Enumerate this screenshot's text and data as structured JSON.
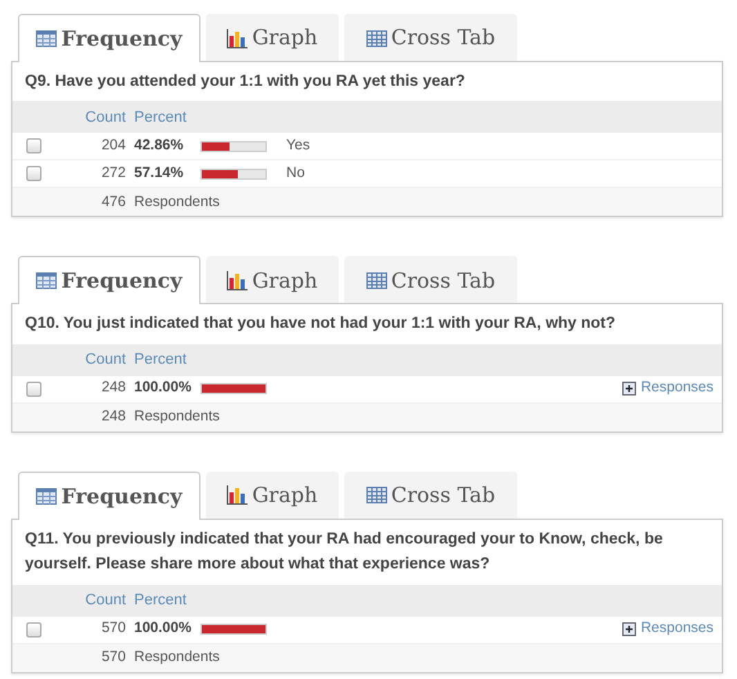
{
  "sections": [
    {
      "tabs": [
        {
          "label": "Frequency",
          "kind": "table",
          "selected": true
        },
        {
          "label": "Graph",
          "kind": "chart",
          "selected": false
        },
        {
          "label": "Cross Tab",
          "kind": "crosstab",
          "selected": false
        }
      ],
      "question": "Q9. Have you attended your 1:1 with you RA yet this year?",
      "columns": [
        "Count",
        "Percent"
      ],
      "rows": [
        {
          "checked": false,
          "count": "204",
          "percent": "42.86%",
          "level": 0.4286,
          "label": "Yes"
        },
        {
          "checked": false,
          "count": "272",
          "percent": "57.14%",
          "level": 0.5714,
          "label": "No"
        }
      ],
      "respondents": {
        "count": "476",
        "label": "Respondents"
      }
    },
    {
      "tabs": [
        {
          "label": "Frequency",
          "kind": "table",
          "selected": true
        },
        {
          "label": "Graph",
          "kind": "chart",
          "selected": false
        },
        {
          "label": "Cross Tab",
          "kind": "crosstab",
          "selected": false
        }
      ],
      "question": "Q10. You just indicated that you have not had your 1:1 with your RA, why not?",
      "columns": [
        "Count",
        "Percent"
      ],
      "rows": [
        {
          "checked": false,
          "count": "248",
          "percent": "100.00%",
          "level": 1,
          "link": "Responses"
        }
      ],
      "respondents": {
        "count": "248",
        "label": "Respondents"
      }
    },
    {
      "tabs": [
        {
          "label": "Frequency",
          "kind": "table",
          "selected": true
        },
        {
          "label": "Graph",
          "kind": "chart",
          "selected": false
        },
        {
          "label": "Cross Tab",
          "kind": "crosstab",
          "selected": false
        }
      ],
      "question": "Q11. You previously indicated that your RA had encouraged your to Know, check, be yourself. Please share more about what that experience was?",
      "columns": [
        "Count",
        "Percent"
      ],
      "rows": [
        {
          "checked": false,
          "count": "570",
          "percent": "100.00%",
          "level": 1,
          "link": "Responses"
        }
      ],
      "respondents": {
        "count": "570",
        "label": "Respondents"
      }
    }
  ]
}
